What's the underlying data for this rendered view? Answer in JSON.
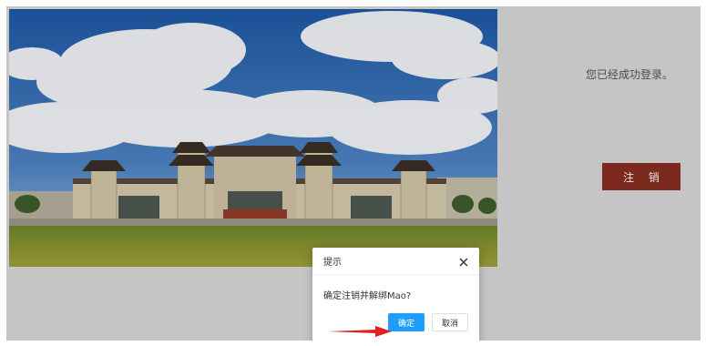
{
  "photo": {
    "icon": "campus-gate-image"
  },
  "status": {
    "message": "您已经成功登录。"
  },
  "logout": {
    "label": "注 销",
    "color": "#8b2f24"
  },
  "dialog": {
    "title": "提示",
    "message": "确定注销并解绑Mao?",
    "confirm_label": "确定",
    "cancel_label": "取消",
    "confirm_color": "#1e9fff"
  },
  "annotation": {
    "icon": "red-arrow-icon",
    "color": "#e02020"
  }
}
